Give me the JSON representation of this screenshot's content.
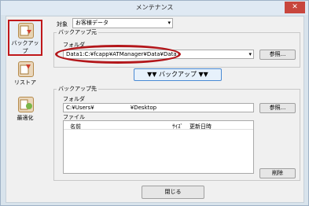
{
  "window": {
    "title": "メンテナンス",
    "close_glyph": "✕"
  },
  "nav": {
    "items": [
      {
        "label": "バックアップ",
        "icon": "backup-icon",
        "active": true
      },
      {
        "label": "リストア",
        "icon": "restore-icon",
        "active": false
      },
      {
        "label": "最適化",
        "icon": "optimize-icon",
        "active": false
      }
    ]
  },
  "target": {
    "label": "対象",
    "value": "お客様データ"
  },
  "source": {
    "caption": "バックアップ元",
    "folder_label": "フォルダ",
    "folder_value": "Data1:C:¥fcapp¥ATManager¥Data¥Data1",
    "browse_label": "参照..."
  },
  "backup_button": {
    "label": "▼▼ バックアップ ▼▼"
  },
  "destination": {
    "caption": "バックアップ先",
    "folder_label": "フォルダ",
    "path_prefix": "C:¥Users¥",
    "path_suffix": "¥Desktop",
    "browse_label": "参照...",
    "file_label": "ファイル",
    "columns": {
      "name": "名前",
      "size": "ｻｲｽﾞ",
      "date": "更新日時"
    },
    "delete_label": "削除"
  },
  "close_button": {
    "label": "閉じる"
  },
  "colors": {
    "highlight": "#c0181a",
    "accent": "#4a8ad4"
  }
}
